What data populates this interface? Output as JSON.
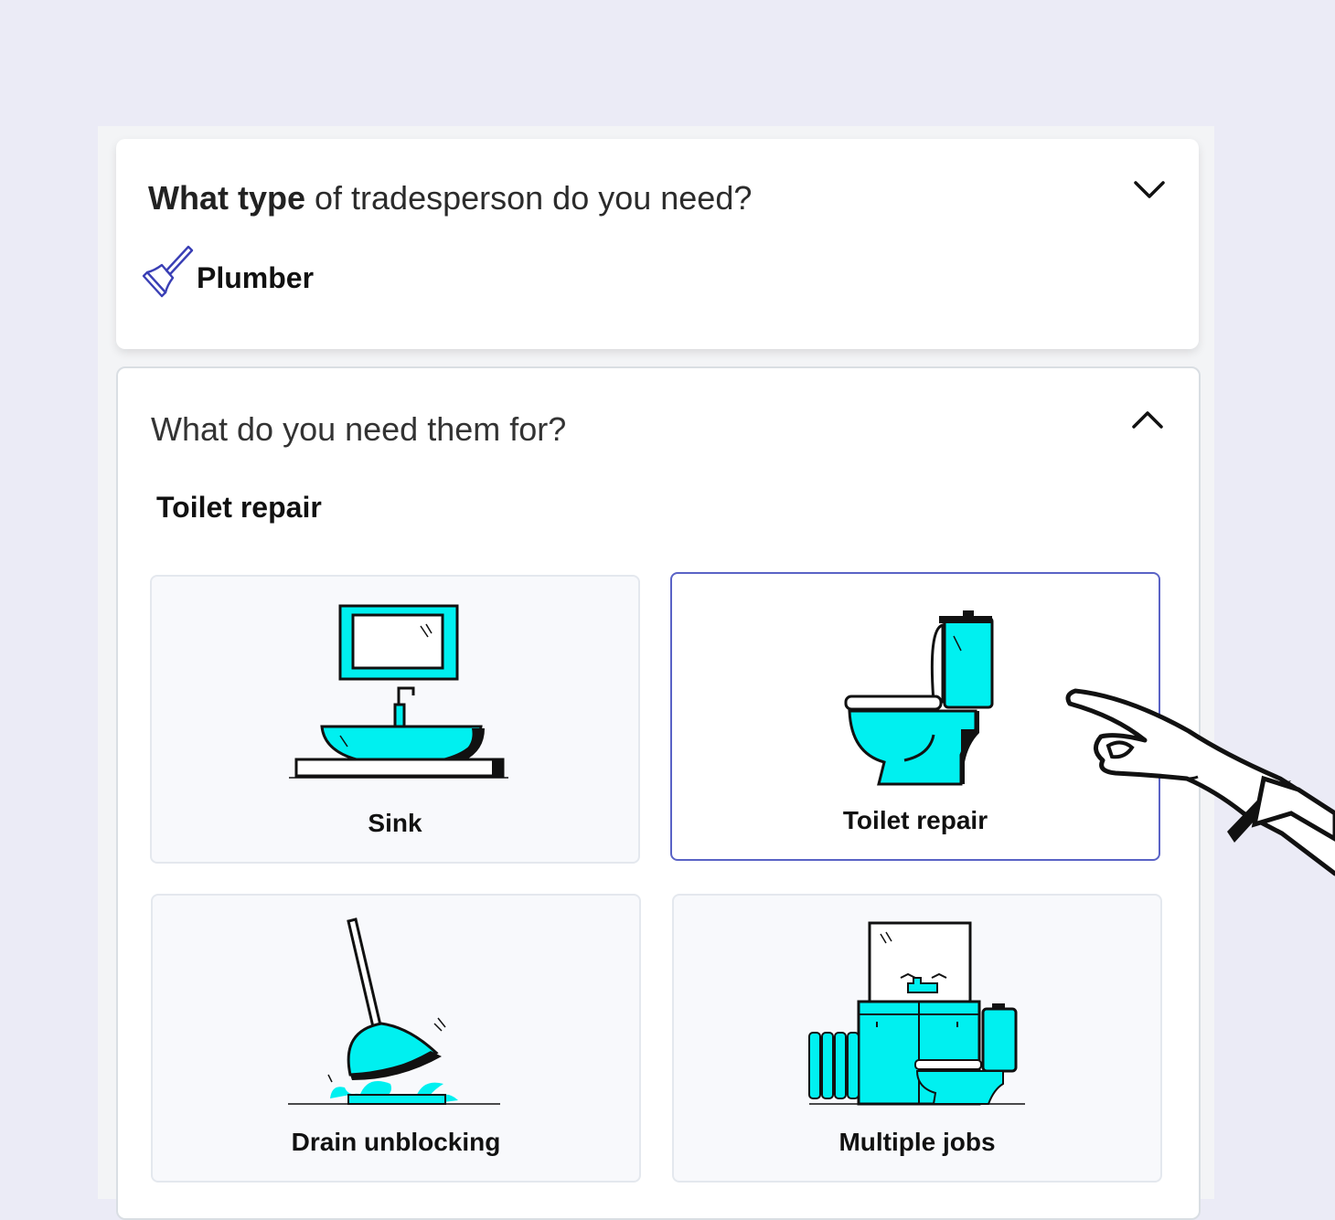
{
  "type_question": {
    "bold_part": "What type",
    "rest_part": " of tradesperson do you need?",
    "selected_value": "Plumber",
    "selected_icon": "plunger-icon",
    "toggle_icon": "chevron-down-icon"
  },
  "job_question": {
    "title": "What do you need them for?",
    "selected_value": "Toilet repair",
    "toggle_icon": "chevron-up-icon"
  },
  "options": [
    {
      "label": "Sink",
      "icon": "sink-illustration",
      "selected": false
    },
    {
      "label": "Toilet repair",
      "icon": "toilet-illustration",
      "selected": true
    },
    {
      "label": "Drain unblocking",
      "icon": "plunger-drain-illustration",
      "selected": false
    },
    {
      "label": "Multiple jobs",
      "icon": "bathroom-illustration",
      "selected": false
    }
  ],
  "colors": {
    "page_background": "#EBEBF6",
    "accent_cyan": "#00F0F0",
    "selection_border": "#5A63C6",
    "plunger_icon": "#3A3FB5"
  }
}
